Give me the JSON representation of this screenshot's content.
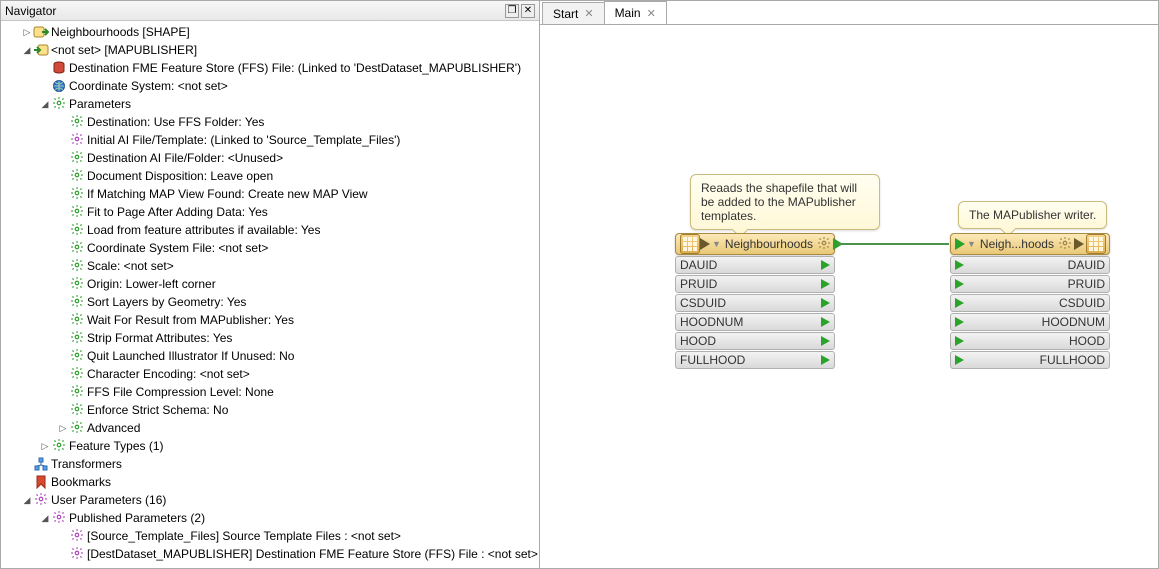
{
  "navigator": {
    "title": "Navigator",
    "tree": [
      {
        "indent": 1,
        "twisty": "▷",
        "icon": "dataset-in",
        "label": "Neighbourhoods [SHAPE]",
        "name": "reader-dataset"
      },
      {
        "indent": 1,
        "twisty": "◢",
        "icon": "dataset-out",
        "label": "<not set>  [MAPUBLISHER]",
        "name": "writer-dataset"
      },
      {
        "indent": 2,
        "twisty": "",
        "icon": "db",
        "label": "Destination FME Feature Store (FFS) File: (Linked to 'DestDataset_MAPUBLISHER')",
        "name": "param-dest-ffs"
      },
      {
        "indent": 2,
        "twisty": "",
        "icon": "globe",
        "label": "Coordinate System: <not set>",
        "name": "param-coordsys"
      },
      {
        "indent": 2,
        "twisty": "◢",
        "icon": "gear-g",
        "label": "Parameters",
        "name": "param-group"
      },
      {
        "indent": 3,
        "twisty": "",
        "icon": "gear-g",
        "label": "Destination: Use FFS Folder: Yes",
        "name": "p-dest"
      },
      {
        "indent": 3,
        "twisty": "",
        "icon": "gear-p",
        "label": "Initial AI File/Template: (Linked to 'Source_Template_Files')",
        "name": "p-init-ai"
      },
      {
        "indent": 3,
        "twisty": "",
        "icon": "gear-g",
        "label": "Destination AI File/Folder: <Unused>",
        "name": "p-dest-ai"
      },
      {
        "indent": 3,
        "twisty": "",
        "icon": "gear-g",
        "label": "Document Disposition: Leave open",
        "name": "p-doc-disp"
      },
      {
        "indent": 3,
        "twisty": "",
        "icon": "gear-g",
        "label": "If Matching MAP View Found: Create new MAP View",
        "name": "p-map-view"
      },
      {
        "indent": 3,
        "twisty": "",
        "icon": "gear-g",
        "label": "Fit to Page After Adding Data: Yes",
        "name": "p-fit"
      },
      {
        "indent": 3,
        "twisty": "",
        "icon": "gear-g",
        "label": "Load from feature attributes if available: Yes",
        "name": "p-load"
      },
      {
        "indent": 3,
        "twisty": "",
        "icon": "gear-g",
        "label": "Coordinate System File: <not set>",
        "name": "p-coordfile"
      },
      {
        "indent": 3,
        "twisty": "",
        "icon": "gear-g",
        "label": "Scale: <not set>",
        "name": "p-scale"
      },
      {
        "indent": 3,
        "twisty": "",
        "icon": "gear-g",
        "label": "Origin: Lower-left corner",
        "name": "p-origin"
      },
      {
        "indent": 3,
        "twisty": "",
        "icon": "gear-g",
        "label": "Sort Layers by Geometry: Yes",
        "name": "p-sort"
      },
      {
        "indent": 3,
        "twisty": "",
        "icon": "gear-g",
        "label": "Wait For Result from MAPublisher: Yes",
        "name": "p-wait"
      },
      {
        "indent": 3,
        "twisty": "",
        "icon": "gear-g",
        "label": "Strip Format Attributes: Yes",
        "name": "p-strip"
      },
      {
        "indent": 3,
        "twisty": "",
        "icon": "gear-g",
        "label": "Quit Launched Illustrator If Unused: No",
        "name": "p-quit"
      },
      {
        "indent": 3,
        "twisty": "",
        "icon": "gear-g",
        "label": "Character Encoding: <not set>",
        "name": "p-enc"
      },
      {
        "indent": 3,
        "twisty": "",
        "icon": "gear-g",
        "label": "FFS File Compression Level: None",
        "name": "p-comp"
      },
      {
        "indent": 3,
        "twisty": "",
        "icon": "gear-g",
        "label": "Enforce Strict Schema: No",
        "name": "p-schema"
      },
      {
        "indent": 3,
        "twisty": "▷",
        "icon": "gear-g",
        "label": "Advanced",
        "name": "p-adv"
      },
      {
        "indent": 2,
        "twisty": "▷",
        "icon": "gear-g",
        "label": "Feature Types (1)",
        "name": "feature-types"
      },
      {
        "indent": 1,
        "twisty": "",
        "icon": "xf",
        "label": "Transformers",
        "name": "transformers"
      },
      {
        "indent": 1,
        "twisty": "",
        "icon": "bm",
        "label": "Bookmarks",
        "name": "bookmarks"
      },
      {
        "indent": 1,
        "twisty": "◢",
        "icon": "gear-p",
        "label": "User Parameters (16)",
        "name": "user-params"
      },
      {
        "indent": 2,
        "twisty": "◢",
        "icon": "gear-p",
        "label": "Published Parameters (2)",
        "name": "pub-params"
      },
      {
        "indent": 3,
        "twisty": "",
        "icon": "gear-p",
        "label": "[Source_Template_Files] Source Template Files : <not set>",
        "name": "pp-src"
      },
      {
        "indent": 3,
        "twisty": "",
        "icon": "gear-p",
        "label": "[DestDataset_MAPUBLISHER] Destination FME Feature Store (FFS) File : <not set>",
        "name": "pp-dest"
      }
    ]
  },
  "tabs": [
    {
      "label": "Start",
      "active": false
    },
    {
      "label": "Main",
      "active": true
    }
  ],
  "canvas": {
    "callout1": "Reaads the shapefile that will be added to the MAPublisher templates.",
    "callout2": "The MAPublisher writer.",
    "reader": {
      "title": "Neighbourhoods",
      "attrs": [
        "DAUID",
        "PRUID",
        "CSDUID",
        "HOODNUM",
        "HOOD",
        "FULLHOOD"
      ]
    },
    "writer": {
      "title": "Neigh...hoods",
      "attrs": [
        "DAUID",
        "PRUID",
        "CSDUID",
        "HOODNUM",
        "HOOD",
        "FULLHOOD"
      ]
    }
  }
}
